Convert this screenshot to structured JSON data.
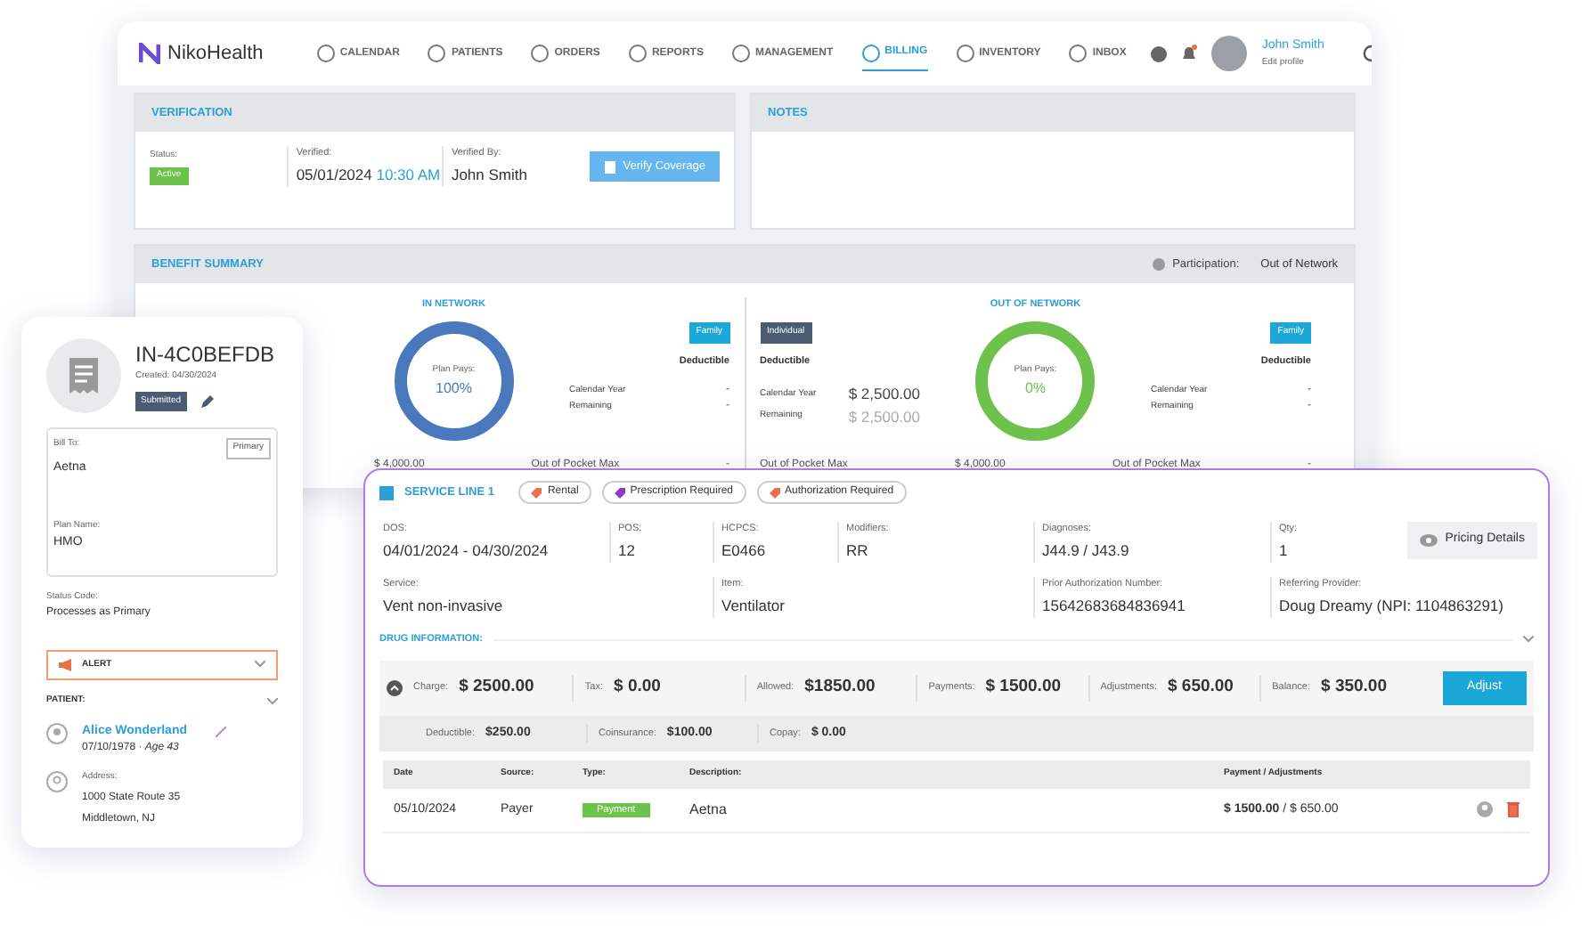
{
  "nav": {
    "brand": "NikoHealth",
    "items": [
      {
        "label": "CALENDAR",
        "selected": false
      },
      {
        "label": "PATIENTS",
        "selected": false
      },
      {
        "label": "ORDERS",
        "selected": false
      },
      {
        "label": "REPORTS",
        "selected": false
      },
      {
        "label": "MANAGEMENT",
        "selected": false
      },
      {
        "label": "BILLING",
        "selected": true
      },
      {
        "label": "INVENTORY",
        "selected": false
      },
      {
        "label": "INBOX",
        "selected": false
      }
    ],
    "user": {
      "name": "John Smith",
      "subtitle": "Edit profile"
    }
  },
  "verification": {
    "title": "VERIFICATION",
    "status_label": "Status:",
    "status": "Active",
    "verified_label": "Verified:",
    "verified_date": "05/01/2024",
    "verified_time": "10:30 AM",
    "verified_by_label": "Verified By:",
    "verified_by": "John Smith",
    "button": "Verify Coverage"
  },
  "notes": {
    "title": "NOTES"
  },
  "benefit_summary": {
    "title": "BENEFIT SUMMARY",
    "participation_label": "Participation:",
    "participation": "Out of Network",
    "networks": [
      {
        "title": "IN NETWORK",
        "color": "#4a78bd",
        "plan_pays_label": "Plan Pays:",
        "plan_pays": "100%",
        "right": {
          "badge": "Family",
          "heading": "Deductible",
          "rows": [
            {
              "label": "Calendar Year",
              "value": "-",
              "muted": false
            },
            {
              "label": "Remaining",
              "value": "-",
              "muted": false
            }
          ]
        },
        "footer": [
          "$ 4,000.00",
          "Out of Pocket Max",
          "-"
        ]
      },
      {
        "title": "OUT OF NETWORK",
        "color": "#6cc24a",
        "plan_pays_label": "Plan Pays:",
        "plan_pays": "0%",
        "left": {
          "badge": "Individual",
          "heading": "Deductible",
          "rows": [
            {
              "label": "Calendar Year",
              "value": "$ 2,500.00",
              "muted": false
            },
            {
              "label": "Remaining",
              "value": "$ 2,500.00",
              "muted": true
            }
          ]
        },
        "right": {
          "badge": "Family",
          "heading": "Deductible",
          "rows": [
            {
              "label": "Calendar Year",
              "value": "-",
              "muted": false
            },
            {
              "label": "Remaining",
              "value": "-",
              "muted": false
            }
          ]
        },
        "footer": [
          "Out of Pocket Max",
          "$ 4,000.00",
          "Out of Pocket Max",
          "-"
        ]
      }
    ]
  },
  "invoice": {
    "number": "IN-4C0BEFDB",
    "created": "Created: 04/30/2024",
    "status": "Submitted",
    "bill_to_label": "Bill To:",
    "bill_to": "Aetna",
    "bill_to_badge": "Primary",
    "plan_name_label": "Plan Name:",
    "plan_name": "HMO",
    "status_code_label": "Status Code:",
    "status_code": "Processes as Primary",
    "alert": "ALERT",
    "patient_label": "PATIENT:",
    "patient_name": "Alice Wonderland",
    "patient_dob": "07/10/1978 · *Age 43*",
    "address_label": "Address:",
    "address_lines": [
      "1000 State Route 35",
      "Middletown, NJ"
    ]
  },
  "service_line": {
    "title": "SERVICE LINE 1",
    "expanded": true,
    "tags": [
      {
        "label": "Rental",
        "color": "#e8734a"
      },
      {
        "label": "Prescription Required",
        "color": "#8e3cc9"
      },
      {
        "label": "Authorization Required",
        "color": "#e8734a"
      }
    ],
    "fields_row_1": [
      {
        "label": "DOS:",
        "value": "04/01/2024 - 04/30/2024"
      },
      {
        "label": "POS:",
        "value": "12"
      },
      {
        "label": "HCPCS:",
        "value": "E0466"
      },
      {
        "label": "Modifiers:",
        "value": "RR"
      },
      {
        "label": "Diagnoses:",
        "value": "J44.9   /   J43.9"
      },
      {
        "label": "Qty:",
        "value": "1"
      }
    ],
    "pricing_button": "Pricing Details",
    "fields_row_2": [
      {
        "label": "Service:",
        "value": "Vent non-invasive"
      },
      {
        "label": "Item:",
        "value": "Ventilator"
      },
      {
        "label": "Prior Authorization Number:",
        "value": "15642683684836941"
      },
      {
        "label": "Referring Provider:",
        "value": "Doug Dreamy (NPI: 1104863291)"
      }
    ],
    "drug_information": "DRUG INFORMATION:",
    "totals": [
      {
        "label": "Charge:",
        "value": "$ 2500.00"
      },
      {
        "label": "Tax:",
        "value": "$ 0.00"
      },
      {
        "label": "Allowed:",
        "value": "$1850.00"
      },
      {
        "label": "Payments:",
        "value": "$ 1500.00"
      },
      {
        "label": "Adjustments:",
        "value": "$ 650.00"
      },
      {
        "label": "Balance:",
        "value": "$ 350.00"
      }
    ],
    "adjust_button": "Adjust",
    "breakdown": [
      {
        "label": "Deductible:",
        "value": "$250.00"
      },
      {
        "label": "Coinsurance:",
        "value": "$100.00"
      },
      {
        "label": "Copay:",
        "value": "$ 0.00"
      }
    ],
    "table": {
      "columns": [
        "Date",
        "Source:",
        "Type:",
        "Description:",
        "Payment / Adjustments"
      ],
      "rows": [
        {
          "date": "05/10/2024",
          "source": "Payer",
          "type": "Payment",
          "description": "Aetna",
          "amount": "**$ 1500.00** / $ 650.00"
        }
      ]
    }
  }
}
